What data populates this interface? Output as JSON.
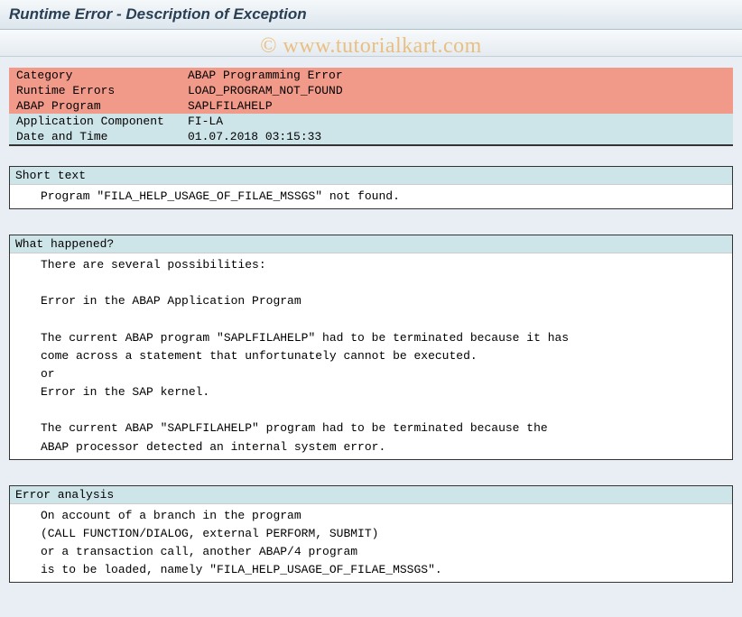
{
  "header": {
    "title": "Runtime Error - Description of Exception"
  },
  "watermark": "© www.tutorialkart.com",
  "info": {
    "rows": [
      {
        "label": "Category",
        "value": "ABAP Programming Error",
        "style": "red"
      },
      {
        "label": "Runtime Errors",
        "value": "LOAD_PROGRAM_NOT_FOUND",
        "style": "red"
      },
      {
        "label": "ABAP Program",
        "value": "SAPLFILAHELP",
        "style": "red"
      },
      {
        "label": "Application Component",
        "value": "FI-LA",
        "style": "blue"
      },
      {
        "label": "Date and Time",
        "value": "01.07.2018 03:15:33",
        "style": "blue"
      }
    ]
  },
  "sections": {
    "short_text": {
      "title": "Short text",
      "body": "Program \"FILA_HELP_USAGE_OF_FILAE_MSSGS\" not found."
    },
    "what_happened": {
      "title": "What happened?",
      "body": "There are several possibilities:\n\nError in the ABAP Application Program\n\nThe current ABAP program \"SAPLFILAHELP\" had to be terminated because it has\ncome across a statement that unfortunately cannot be executed.\nor\nError in the SAP kernel.\n\nThe current ABAP \"SAPLFILAHELP\" program had to be terminated because the\nABAP processor detected an internal system error."
    },
    "error_analysis": {
      "title": "Error analysis",
      "body": "On account of a branch in the program\n(CALL FUNCTION/DIALOG, external PERFORM, SUBMIT)\nor a transaction call, another ABAP/4 program\nis to be loaded, namely \"FILA_HELP_USAGE_OF_FILAE_MSSGS\"."
    }
  }
}
